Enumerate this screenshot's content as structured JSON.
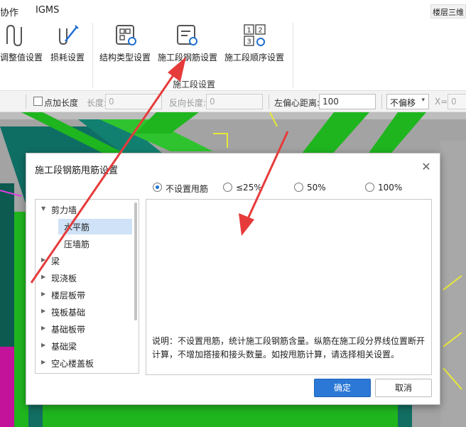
{
  "menubar": {
    "items": [
      "协作",
      "IGMS"
    ],
    "floor_button": "楼层三维"
  },
  "ribbon": {
    "buttons": [
      {
        "label": "调整值设置",
        "icon": "adjust-value-icon"
      },
      {
        "label": "损耗设置",
        "icon": "loss-setting-icon"
      },
      {
        "label": "结构类型设置",
        "icon": "structure-type-icon"
      },
      {
        "label": "施工段钢筋设置",
        "icon": "segment-rebar-icon"
      },
      {
        "label": "施工段顺序设置",
        "icon": "segment-order-icon"
      }
    ],
    "order_digits": [
      "1",
      "2",
      "3"
    ],
    "group_label": "施工段设置"
  },
  "propbar": {
    "add_length_label": "点加长度",
    "length_label": "长度:",
    "length_value": "0",
    "reverse_length_label": "反向长度:",
    "reverse_length_value": "0",
    "left_offset_label": "左偏心距离:",
    "left_offset_value": "100",
    "offset_select": "不偏移",
    "x_label": "X=",
    "x_value": "0"
  },
  "dialog": {
    "title": "施工段钢筋甩筋设置",
    "radio_options": [
      {
        "label": "不设置甩筋",
        "selected": true
      },
      {
        "label": "≤25%",
        "selected": false
      },
      {
        "label": "50%",
        "selected": false
      },
      {
        "label": "100%",
        "selected": false
      }
    ],
    "tree": [
      {
        "label": "剪力墙",
        "level": 0,
        "expanded": true
      },
      {
        "label": "水平筋",
        "level": 1,
        "selected": true
      },
      {
        "label": "压墙筋",
        "level": 1
      },
      {
        "label": "梁",
        "level": 0
      },
      {
        "label": "现浇板",
        "level": 0
      },
      {
        "label": "楼层板带",
        "level": 0
      },
      {
        "label": "筏板基础",
        "level": 0
      },
      {
        "label": "基础板带",
        "level": 0
      },
      {
        "label": "基础梁",
        "level": 0
      },
      {
        "label": "空心楼盖板",
        "level": 0
      }
    ],
    "note": "说明：不设置甩筋，统计施工段钢筋含量。纵筋在施工段分界线位置断开计算，不增加搭接和接头数量。如按甩筋计算，请选择相关设置。",
    "ok_label": "确定",
    "cancel_label": "取消"
  },
  "colors": {
    "accent": "#2b78d6",
    "selection": "#cfe2f7",
    "annotation_arrow": "#e63b3b",
    "model_green": "#1fb51f",
    "model_teal": "#0f6e64",
    "model_magenta": "#c2139a",
    "model_yellow": "#e8e83a"
  }
}
